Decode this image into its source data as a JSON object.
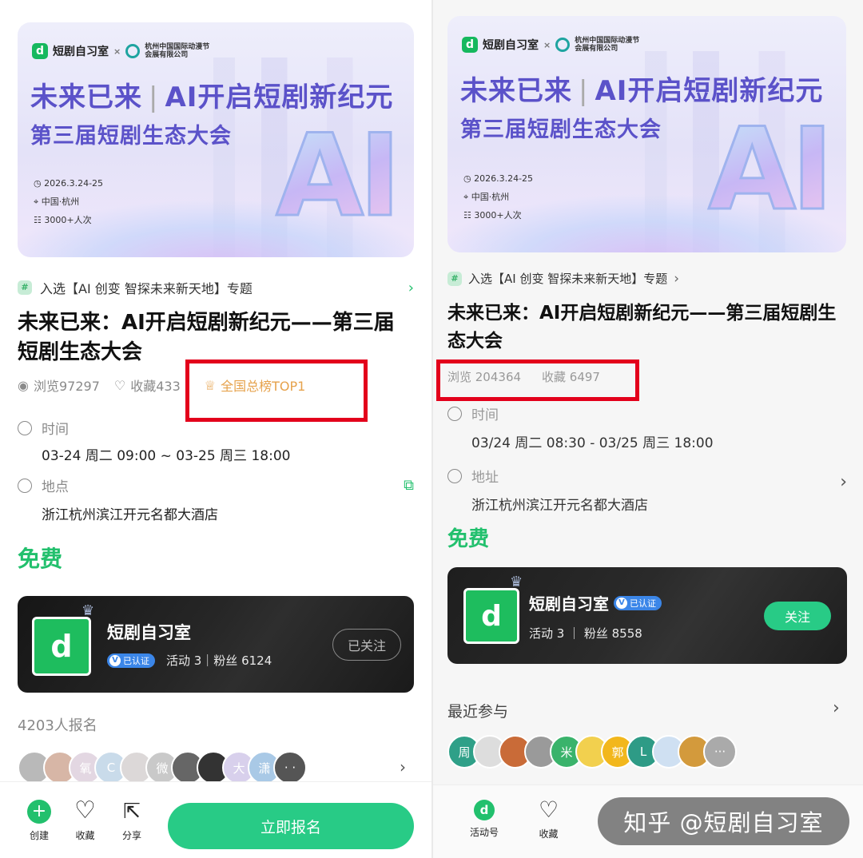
{
  "left": {
    "banner": {
      "logo_text": "短剧自习室",
      "cross": "×",
      "partner_name_line1": "杭州中国国际动漫节",
      "partner_name_line2": "会展有限公司",
      "partner_abbr": "CICAF",
      "title_part1": "未来已来",
      "title_part2": "AI开启短剧新纪元",
      "subtitle": "第三届短剧生态大会",
      "date": "2026.3.24-25",
      "place": "中国·杭州",
      "attendance": "3000+人次",
      "big_text": "AI"
    },
    "topic": "入选【AI 创变 智探未来新天地】专题",
    "title": "未来已来：AI开启短剧新纪元——第三届短剧生态大会",
    "stats": {
      "views": "浏览97297",
      "favorites": "收藏433",
      "rank": "全国总榜TOP1"
    },
    "time_label": "时间",
    "time_value": "03-24 周二 09:00 ~ 03-25 周三 18:00",
    "place_label": "地点",
    "place_value": "浙江杭州滨江开元名都大酒店",
    "price": "免费",
    "org": {
      "name": "短剧自习室",
      "verified": "已认证",
      "stats": "活动 3｜粉丝 6124",
      "follow": "已关注"
    },
    "signups": "4203人报名",
    "avatars": [
      "",
      "",
      "氧",
      "C",
      "",
      "微",
      "",
      "",
      "大",
      "潇",
      "· ·"
    ],
    "bottom": {
      "create": "创建",
      "favorite": "收藏",
      "share": "分享",
      "register": "立即报名"
    }
  },
  "right": {
    "banner": {
      "logo_text": "短剧自习室",
      "cross": "×",
      "partner_name_line1": "杭州中国国际动漫节",
      "partner_name_line2": "会展有限公司",
      "partner_abbr": "CICAF",
      "title_part1": "未来已来",
      "title_part2": "AI开启短剧新纪元",
      "subtitle": "第三届短剧生态大会",
      "date": "2026.3.24-25",
      "place": "中国·杭州",
      "attendance": "3000+人次",
      "big_text": "AI"
    },
    "topic": "入选【AI 创变 智探未来新天地】专题",
    "title": "未来已来：AI开启短剧新纪元——第三届短剧生态大会",
    "stats": {
      "views": "浏览 204364",
      "favorites": "收藏 6497"
    },
    "time_label": "时间",
    "time_value": "03/24 周二 08:30 - 03/25 周三 18:00",
    "place_label": "地址",
    "place_value": "浙江杭州滨江开元名都大酒店",
    "price": "免费",
    "org": {
      "name": "短剧自习室",
      "verified": "已认证",
      "stats": "活动 3 ｜ 粉丝 8558",
      "follow": "关注"
    },
    "recent_label": "最近参与",
    "avatars": [
      "周",
      "",
      "",
      "",
      "米",
      "",
      "郭",
      "L",
      "",
      "",
      "···"
    ],
    "bottom": {
      "activity": "活动号",
      "favorite": "收藏"
    }
  },
  "watermark": "知乎 @短剧自习室",
  "colors": {
    "green": "#22c06d",
    "button_green": "#28cb86",
    "highlight_red": "#e3001b",
    "verified_blue": "#3b86e8",
    "trophy": "#e6a24c"
  }
}
